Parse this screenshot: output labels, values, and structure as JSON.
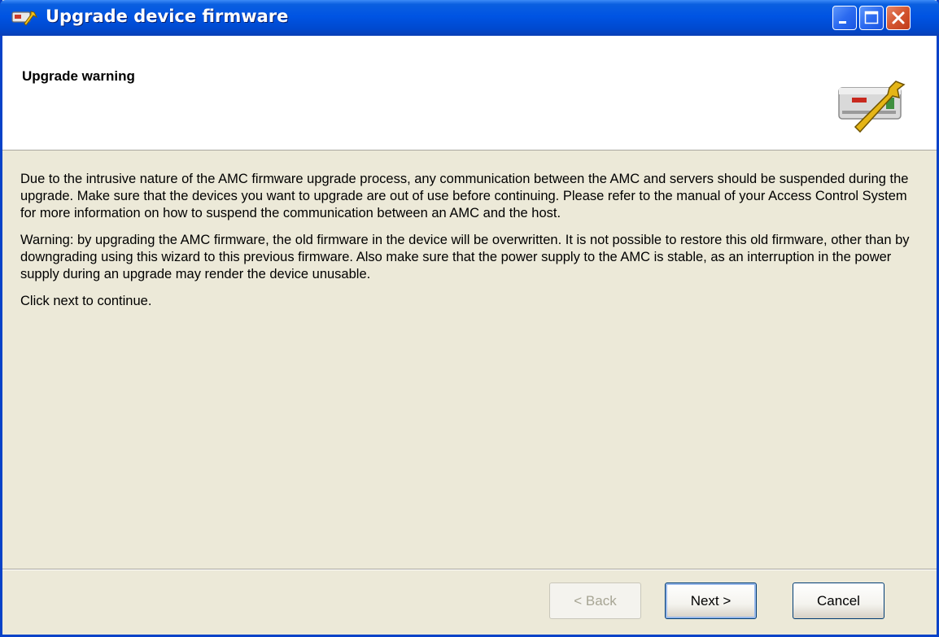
{
  "window": {
    "title": "Upgrade device firmware",
    "icon": "firmware-wizard-icon",
    "controls": [
      "minimize-icon",
      "maximize-icon",
      "close-icon"
    ]
  },
  "header": {
    "title": "Upgrade warning",
    "image": "device-wrench-icon"
  },
  "body": {
    "paragraph1": "Due to the intrusive nature of the AMC firmware upgrade process, any communication between the AMC and servers should be suspended during the upgrade. Make sure that the devices you want to upgrade are out of use before continuing. Please refer to the manual of your Access Control System for more information on how to suspend the communication between an AMC and the host.",
    "paragraph2": "Warning: by upgrading the AMC firmware, the old firmware in the device will be overwritten. It is not possible to restore this old firmware, other than by downgrading using this wizard to this previous firmware. Also make sure that the power supply to the AMC is stable, as an interruption in the power supply during an upgrade may render the device unusable.",
    "paragraph3": "Click next to continue."
  },
  "buttons": {
    "back": "< Back",
    "next": "Next >",
    "cancel": "Cancel"
  },
  "colors": {
    "titlebar": "#0054e3",
    "dialog_background": "#ece9d8",
    "header_background": "#ffffff"
  }
}
